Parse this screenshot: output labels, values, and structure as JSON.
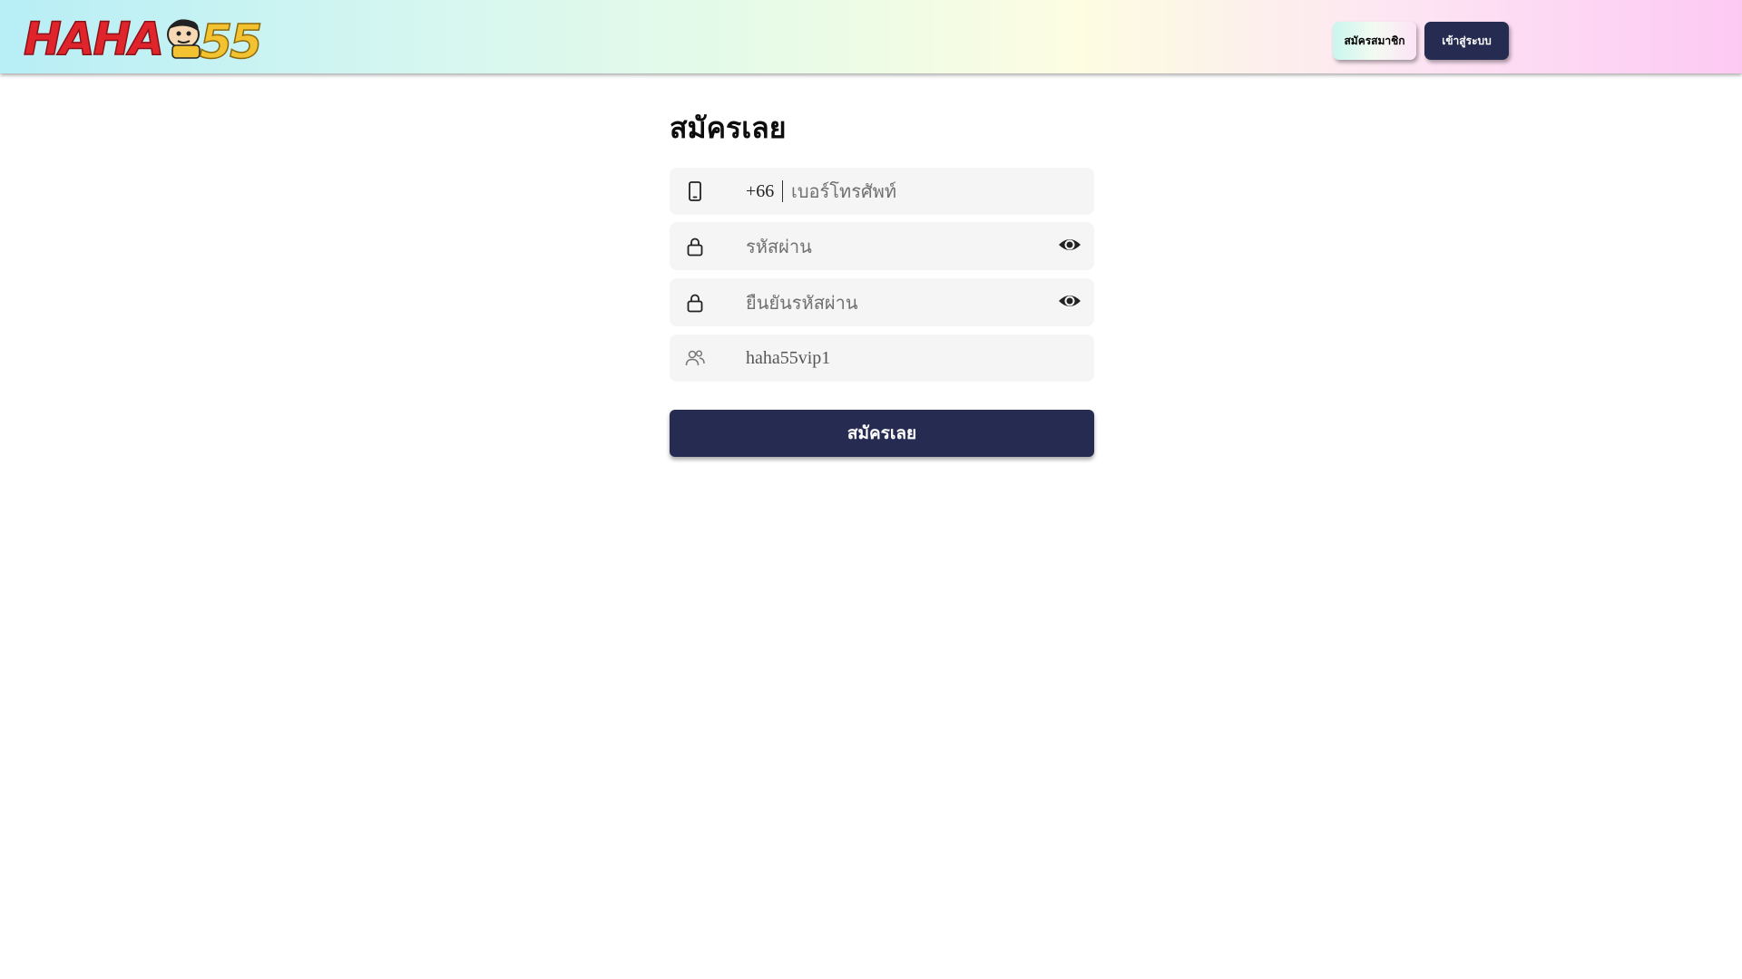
{
  "header": {
    "logo_text": "HAHA55",
    "register_label": "สมัครสมาชิก",
    "login_label": "เข้าสู่ระบบ"
  },
  "form": {
    "title": "สมัครเลย",
    "phone": {
      "icon": "smartphone-icon",
      "prefix": "+66",
      "placeholder": "เบอร์โทรศัพท์"
    },
    "password": {
      "icon": "lock-icon",
      "placeholder": "รหัสผ่าน",
      "toggle_icon": "eye-icon"
    },
    "confirm_password": {
      "icon": "lock-icon",
      "placeholder": "ยืนยันรหัสผ่าน",
      "toggle_icon": "eye-icon"
    },
    "referral": {
      "icon": "users-icon",
      "value": "haha55vip1"
    },
    "submit_label": "สมัครเลย"
  },
  "colors": {
    "primary_button": "#262c51",
    "field_background": "#f5f5f5",
    "logo_red": "#e0242b",
    "logo_gold": "#f2c230"
  }
}
